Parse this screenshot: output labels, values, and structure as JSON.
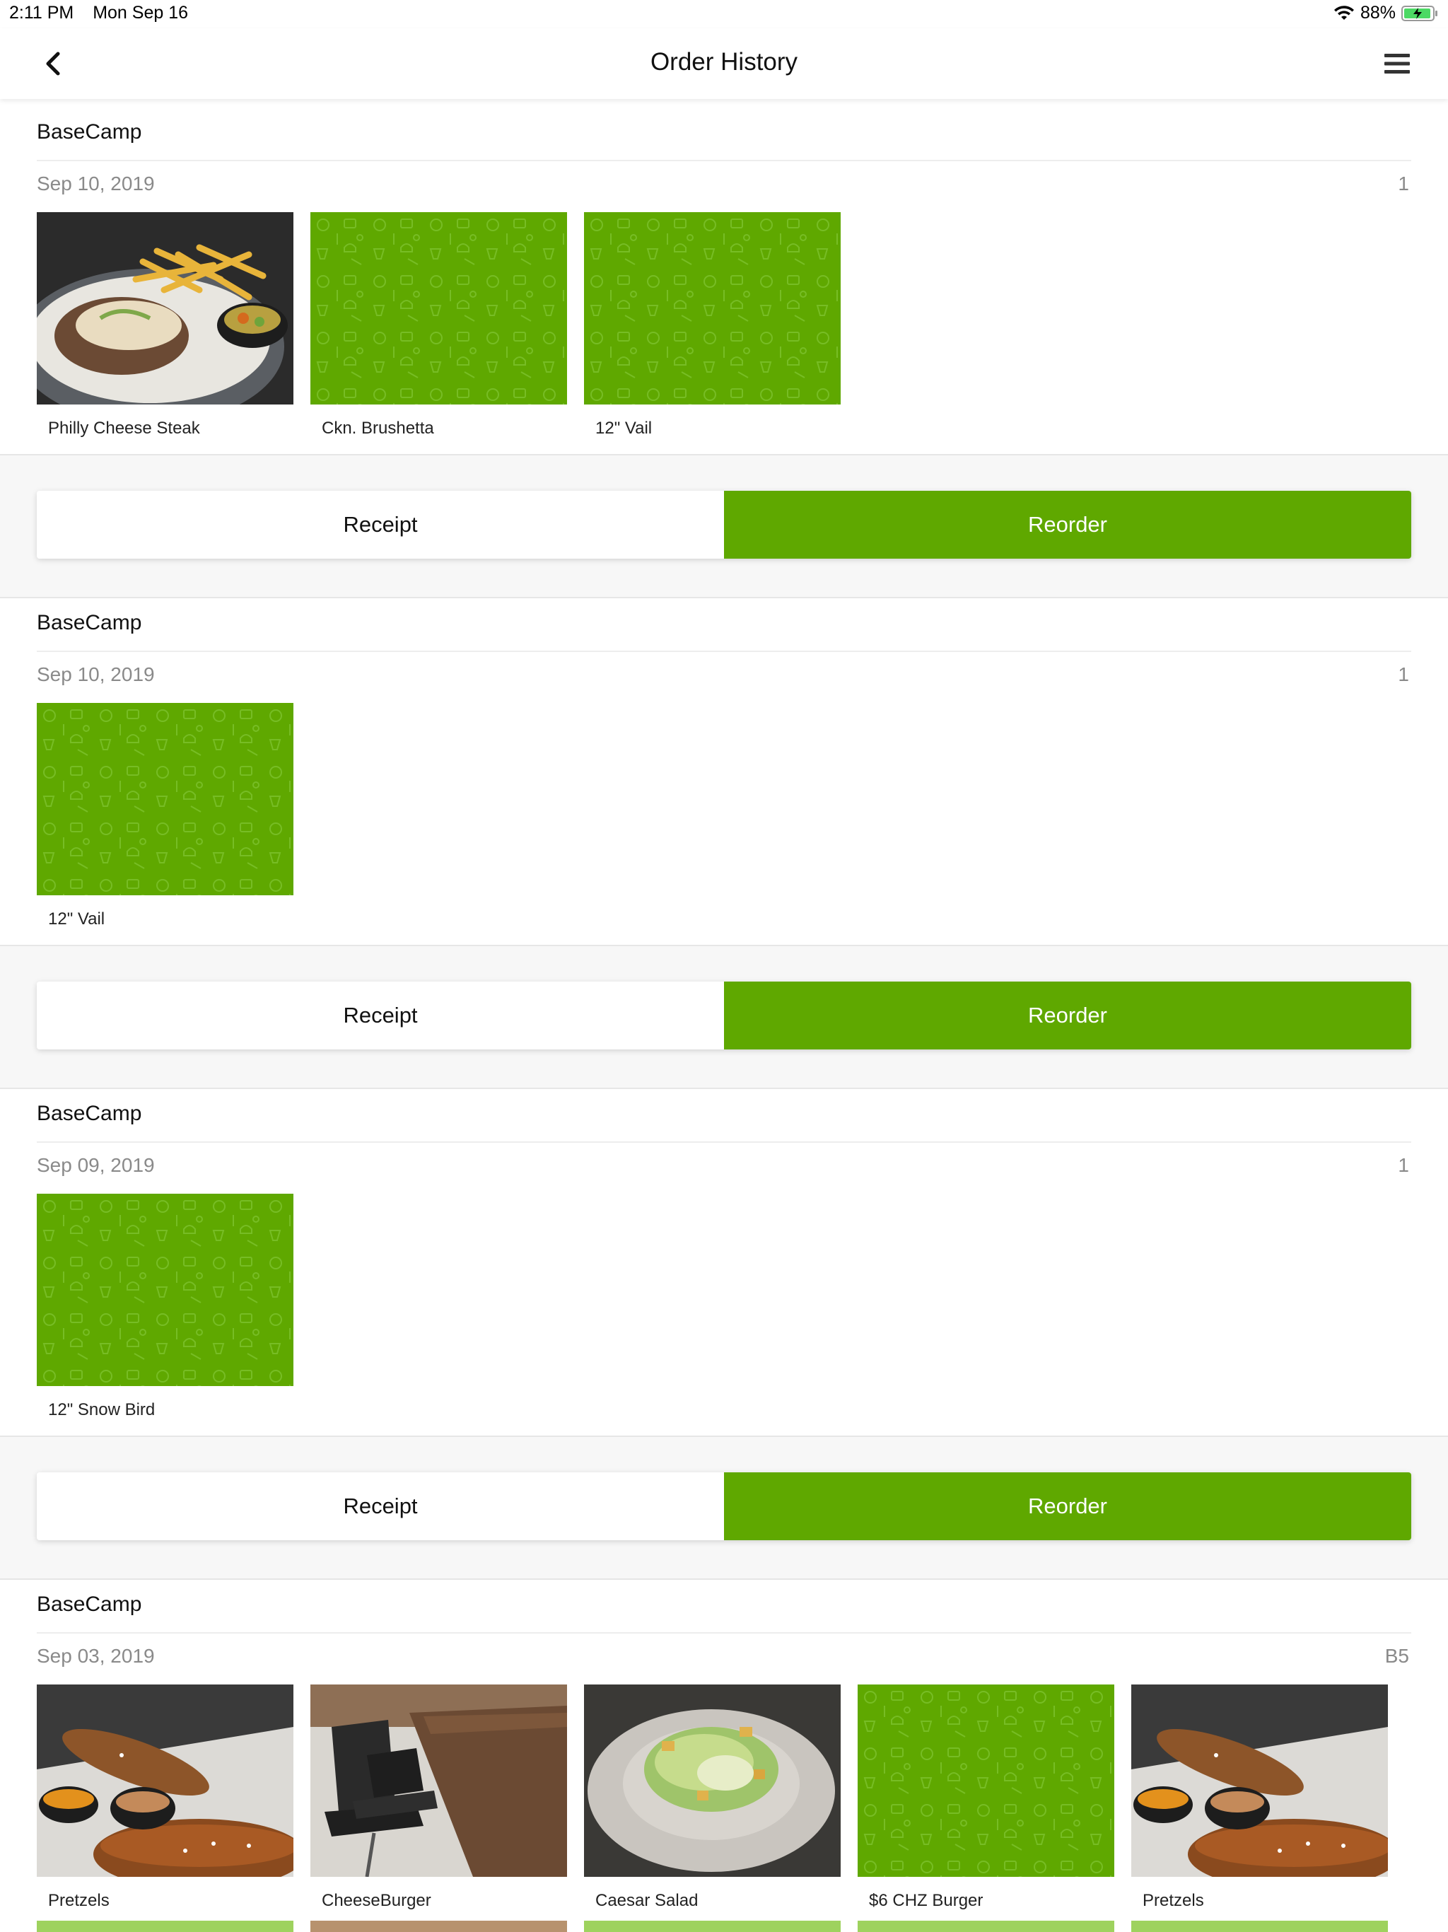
{
  "status_bar": {
    "time": "2:11 PM",
    "date": "Mon Sep 16",
    "battery": "88%"
  },
  "nav": {
    "title": "Order History",
    "back_icon": "chevron-left-icon",
    "menu_icon": "hamburger-menu-icon"
  },
  "colors": {
    "brand_green": "#5fa800",
    "pattern_green": "#6cb21a"
  },
  "orders": [
    {
      "venue": "BaseCamp",
      "date": "Sep 10, 2019",
      "count": "1",
      "items": [
        {
          "name": "Philly Cheese Steak",
          "image": "photo-cheesesteak"
        },
        {
          "name": "Ckn. Brushetta",
          "image": "placeholder-pattern"
        },
        {
          "name": "12\" Vail",
          "image": "placeholder-pattern"
        }
      ],
      "receipt_label": "Receipt",
      "reorder_label": "Reorder"
    },
    {
      "venue": "BaseCamp",
      "date": "Sep 10, 2019",
      "count": "1",
      "items": [
        {
          "name": "12\" Vail",
          "image": "placeholder-pattern"
        }
      ],
      "receipt_label": "Receipt",
      "reorder_label": "Reorder"
    },
    {
      "venue": "BaseCamp",
      "date": "Sep 09, 2019",
      "count": "1",
      "items": [
        {
          "name": "12\" Snow Bird",
          "image": "placeholder-pattern"
        }
      ],
      "receipt_label": "Receipt",
      "reorder_label": "Reorder"
    },
    {
      "venue": "BaseCamp",
      "date": "Sep 03, 2019",
      "count": "B5",
      "items": [
        {
          "name": "Pretzels",
          "image": "photo-pretzels"
        },
        {
          "name": "CheeseBurger",
          "image": "photo-table"
        },
        {
          "name": "Caesar Salad",
          "image": "photo-salad"
        },
        {
          "name": "$6 CHZ Burger",
          "image": "placeholder-pattern"
        },
        {
          "name": "Pretzels",
          "image": "photo-pretzels"
        }
      ]
    }
  ]
}
